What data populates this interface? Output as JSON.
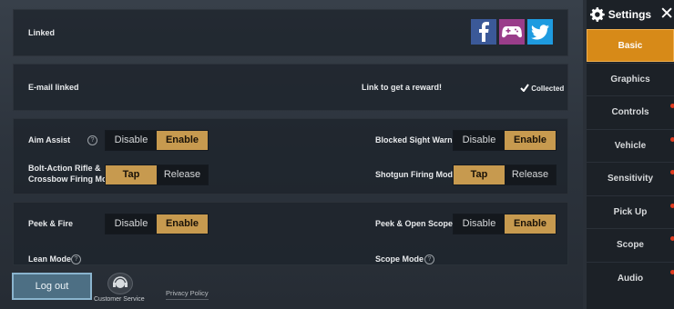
{
  "panels": {
    "linked": {
      "label": "Linked",
      "social": [
        "facebook-icon",
        "gamecenter-icon",
        "twitter-icon"
      ]
    },
    "email": {
      "label": "E-mail linked",
      "reward_text": "Link to get a reward!",
      "collected": "Collected"
    },
    "aim_assist": {
      "label": "Aim Assist",
      "options": [
        "Disable",
        "Enable"
      ],
      "selected": "Enable"
    },
    "blocked_sight": {
      "label": "Blocked Sight Warning",
      "options": [
        "Disable",
        "Enable"
      ],
      "selected": "Enable"
    },
    "bolt_action": {
      "label_line1": "Bolt-Action Rifle &",
      "label_line2": "Crossbow Firing Mode",
      "options": [
        "Tap",
        "Release"
      ],
      "selected": "Tap"
    },
    "shotgun": {
      "label": "Shotgun Firing Mode",
      "options": [
        "Tap",
        "Release"
      ],
      "selected": "Tap"
    },
    "peek_fire": {
      "label": "Peek & Fire",
      "options": [
        "Disable",
        "Enable"
      ],
      "selected": "Enable"
    },
    "peek_scope": {
      "label": "Peek & Open Scope",
      "options": [
        "Disable",
        "Enable"
      ],
      "selected": "Enable"
    },
    "lean_mode": {
      "label": "Lean Mode"
    },
    "scope_mode": {
      "label": "Scope Mode"
    }
  },
  "help_glyph": "?",
  "sidebar": {
    "title": "Settings",
    "close_glyph": "✕",
    "items": [
      {
        "label": "Basic",
        "active": true,
        "dot": false
      },
      {
        "label": "Graphics",
        "active": false,
        "dot": false
      },
      {
        "label": "Controls",
        "active": false,
        "dot": true
      },
      {
        "label": "Vehicle",
        "active": false,
        "dot": true
      },
      {
        "label": "Sensitivity",
        "active": false,
        "dot": true
      },
      {
        "label": "Pick Up",
        "active": false,
        "dot": true
      },
      {
        "label": "Scope",
        "active": false,
        "dot": true
      },
      {
        "label": "Audio",
        "active": false,
        "dot": true
      }
    ]
  },
  "footer": {
    "logout": "Log out",
    "customer_service": "Customer Service",
    "privacy_policy": "Privacy Policy"
  },
  "colors": {
    "accent": "#c79a4f",
    "sidebar_active": "#d78a18",
    "facebook": "#3b5998",
    "twitter": "#1e9be0",
    "gamecenter": "#9a3d8a"
  }
}
